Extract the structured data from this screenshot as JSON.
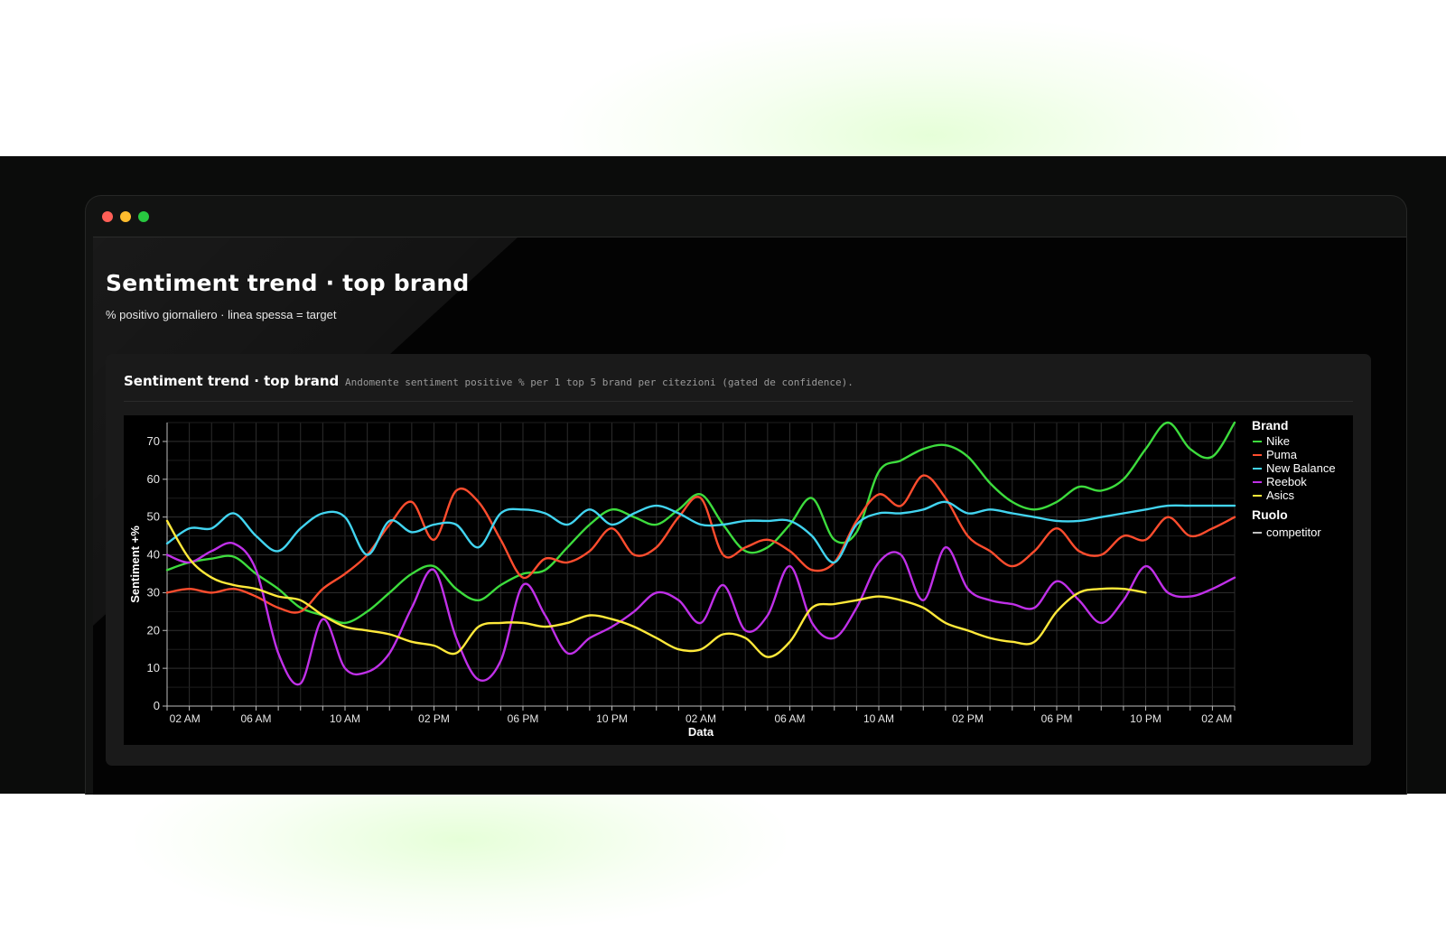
{
  "page": {
    "title": "Sentiment trend · top brand",
    "subtitle": "% positivo giornaliero · linea spessa = target"
  },
  "card": {
    "title": "Sentiment trend · top brand",
    "description": "Andomente sentiment positive % per 1 top 5 brand per citezioni (gated de confidence)."
  },
  "window_controls": [
    "close",
    "minimize",
    "maximize"
  ],
  "chart_data": {
    "type": "line",
    "xlabel": "Data",
    "ylabel": "Sentiment +%",
    "ylim": [
      0,
      75
    ],
    "yticks": [
      0,
      10,
      20,
      30,
      40,
      50,
      60,
      70
    ],
    "x_range": [
      0,
      48
    ],
    "x": [
      0,
      1,
      2,
      3,
      4,
      5,
      6,
      7,
      8,
      9,
      10,
      11,
      12,
      13,
      14,
      15,
      16,
      17,
      18,
      19,
      20,
      21,
      22,
      23,
      24,
      25,
      26,
      27,
      28,
      29,
      30,
      31,
      32,
      33,
      34,
      35,
      36,
      37,
      38,
      39,
      40,
      41,
      42,
      43,
      44,
      45,
      46,
      47,
      48
    ],
    "xticks": [
      {
        "x": 0.8,
        "label": "02 AM"
      },
      {
        "x": 4,
        "label": "06 AM"
      },
      {
        "x": 8,
        "label": "10 AM"
      },
      {
        "x": 12,
        "label": "02 PM"
      },
      {
        "x": 16,
        "label": "06 PM"
      },
      {
        "x": 20,
        "label": "10 PM"
      },
      {
        "x": 24,
        "label": "02 AM"
      },
      {
        "x": 28,
        "label": "06 AM"
      },
      {
        "x": 32,
        "label": "10 AM"
      },
      {
        "x": 36,
        "label": "02 PM"
      },
      {
        "x": 40,
        "label": "06 PM"
      },
      {
        "x": 44,
        "label": "10 PM"
      },
      {
        "x": 47.2,
        "label": "02 AM"
      }
    ],
    "legend_position": "right",
    "legend_brand_title": "Brand",
    "legend_role_title": "Ruolo",
    "role_entries": [
      {
        "label": "competitor",
        "color": "#ffffff"
      }
    ],
    "grid": true,
    "series": [
      {
        "name": "Nike",
        "color": "#3ddc3d",
        "values": [
          36,
          38,
          39,
          39.5,
          35,
          31,
          26,
          24,
          22,
          25,
          30,
          35,
          37,
          31,
          28,
          32,
          35,
          36,
          42,
          48,
          52,
          50,
          48,
          52,
          56,
          48,
          41,
          42,
          48,
          55,
          44,
          46,
          62,
          65,
          68,
          69,
          66,
          59,
          54,
          52,
          54,
          58,
          57,
          60,
          68,
          75,
          68,
          66,
          75
        ]
      },
      {
        "name": "Puma",
        "color": "#ff4d2e",
        "values": [
          30,
          31,
          30,
          31,
          29,
          26,
          25,
          31,
          35,
          40,
          48,
          54,
          44,
          57,
          54,
          44,
          34,
          39,
          38,
          41,
          47,
          40,
          42,
          50,
          55,
          40,
          42,
          44,
          41,
          36,
          38,
          49,
          56,
          53,
          61,
          55,
          45,
          41,
          37,
          41,
          47,
          41,
          40,
          45,
          44,
          50,
          45,
          47,
          50
        ]
      },
      {
        "name": "New Balance",
        "color": "#42d4f0",
        "values": [
          43,
          47,
          47,
          51,
          45,
          41,
          47,
          51,
          50,
          40,
          49,
          46,
          48,
          48,
          42,
          51,
          52,
          51,
          48,
          52,
          48,
          51,
          53,
          51,
          48,
          48,
          49,
          49,
          49,
          45,
          38,
          48,
          51,
          51,
          52,
          54,
          51,
          52,
          51,
          50,
          49,
          49,
          50,
          51,
          52,
          53,
          53,
          53,
          53
        ]
      },
      {
        "name": "Reebok",
        "color": "#c030e8",
        "values": [
          40,
          38,
          41,
          43,
          36,
          14,
          6,
          23,
          10,
          9,
          14,
          26,
          36,
          18,
          7,
          12,
          32,
          24,
          14,
          18,
          21,
          25,
          30,
          28,
          22,
          32,
          20,
          24,
          37,
          22,
          18,
          26,
          38,
          40,
          28,
          42,
          31,
          28,
          27,
          26,
          33,
          28,
          22,
          28,
          37,
          30,
          29,
          31,
          34
        ]
      },
      {
        "name": "Asics",
        "color": "#ffe93a",
        "values": [
          49,
          39,
          34,
          32,
          31,
          29,
          28,
          24,
          21,
          20,
          19,
          17,
          16,
          14,
          21,
          22,
          22,
          21,
          22,
          24,
          23,
          21,
          18,
          15,
          15,
          19,
          18,
          13,
          17,
          26,
          27,
          28,
          29,
          28,
          26,
          22,
          20,
          18,
          17,
          17,
          25,
          30,
          31,
          31,
          30
        ]
      }
    ]
  }
}
